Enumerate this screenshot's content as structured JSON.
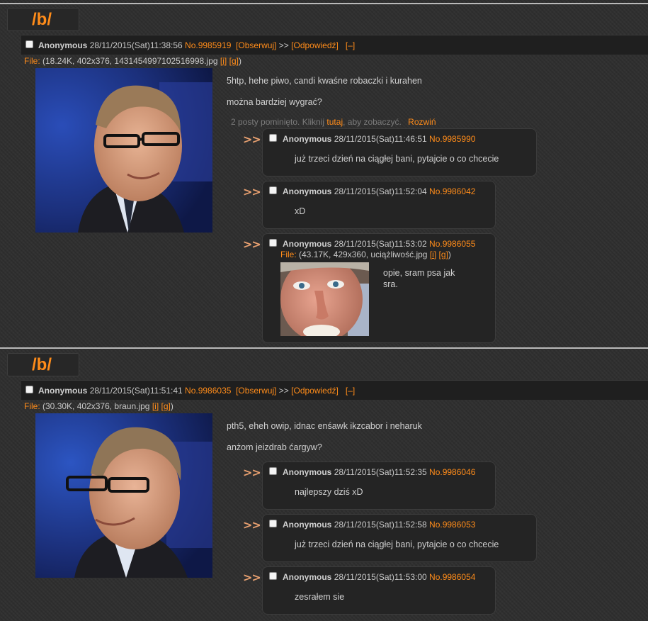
{
  "threads": [
    {
      "board": "/b/",
      "op": {
        "name": "Anonymous",
        "date": "28/11/2015(Sat)11:38:56",
        "no": "No.9985919",
        "watch": "[Obserwuj]",
        "arrow": ">>",
        "reply": "[Odpowiedź]",
        "hide": "[–]",
        "file_label": "File:",
        "file_info": "(18.24K, 402x376, 1431454997102516998.jpg",
        "file_i": "[i]",
        "file_g": "[g]",
        "file_close": ")",
        "lines": [
          "5htp, hehe piwo, candi kwaśne robaczki i kurahen",
          "można bardziej wygrać?"
        ]
      },
      "omitted": {
        "text": "2 posty pominięto. Kliknij",
        "link": "tutaj",
        "rest": ", aby zobaczyć.",
        "expand": "Rozwiń"
      },
      "replies": [
        {
          "name": "Anonymous",
          "date": "28/11/2015(Sat)11:46:51",
          "no": "No.9985990",
          "text": "już trzeci dzień na ciągłej bani, pytajcie o co chcecie"
        },
        {
          "name": "Anonymous",
          "date": "28/11/2015(Sat)11:52:04",
          "no": "No.9986042",
          "text": "xD"
        },
        {
          "name": "Anonymous",
          "date": "28/11/2015(Sat)11:53:02",
          "no": "No.9986055",
          "file_label": "File:",
          "file_info": "(43.17K, 429x360, uciążliwość.jpg",
          "file_i": "[i]",
          "file_g": "[g]",
          "file_close": ")",
          "text": "opie, sram psa jak",
          "text2": "sra."
        }
      ]
    },
    {
      "board": "/b/",
      "op": {
        "name": "Anonymous",
        "date": "28/11/2015(Sat)11:51:41",
        "no": "No.9986035",
        "watch": "[Obserwuj]",
        "arrow": ">>",
        "reply": "[Odpowiedź]",
        "hide": "[–]",
        "file_label": "File:",
        "file_info": "(30.30K, 402x376, braun.jpg",
        "file_i": "[i]",
        "file_g": "[g]",
        "file_close": ")",
        "lines": [
          "pth5, eheh owip, idnac enśawk ikzcabor i neharuk",
          "anżom jeizdrab ćargyw?"
        ]
      },
      "replies": [
        {
          "name": "Anonymous",
          "date": "28/11/2015(Sat)11:52:35",
          "no": "No.9986046",
          "text": "najlepszy dziś xD"
        },
        {
          "name": "Anonymous",
          "date": "28/11/2015(Sat)11:52:58",
          "no": "No.9986053",
          "text": "już trzeci dzień na ciągłej bani, pytajcie o co chcecie"
        },
        {
          "name": "Anonymous",
          "date": "28/11/2015(Sat)11:53:00",
          "no": "No.9986054",
          "text": "zesrałem sie"
        }
      ]
    }
  ],
  "reply_arrow": ">>",
  "colors": {
    "accent": "#ff8c1a",
    "background": "#2e2e2e",
    "reply_bg": "#242424"
  }
}
